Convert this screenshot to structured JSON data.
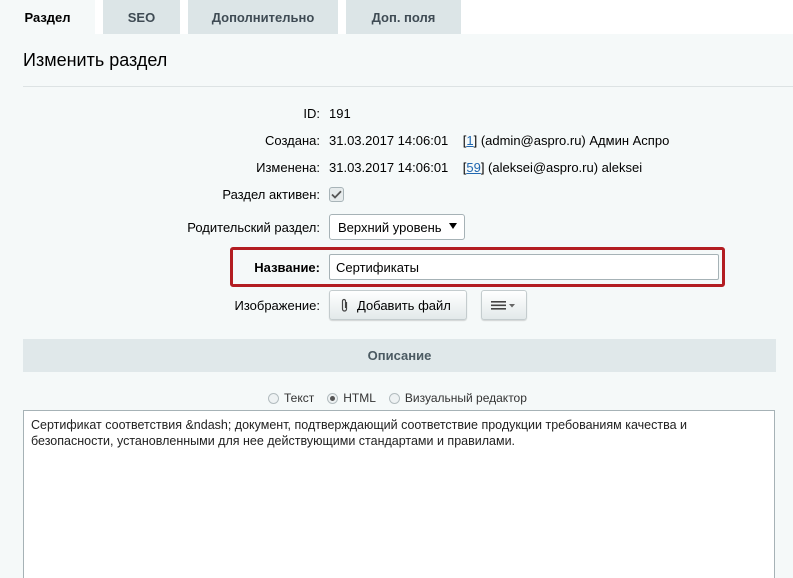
{
  "tabs": [
    {
      "label": "Раздел",
      "active": true
    },
    {
      "label": "SEO",
      "active": false
    },
    {
      "label": "Дополнительно",
      "active": false
    },
    {
      "label": "Доп. поля",
      "active": false
    }
  ],
  "page": {
    "title": "Изменить раздел"
  },
  "fields": {
    "id": {
      "label": "ID:",
      "value": "191"
    },
    "created": {
      "label": "Создана:",
      "date": "31.03.2017 14:06:01",
      "user_link": "1",
      "user_text": "(admin@aspro.ru) Админ Аспро"
    },
    "modified": {
      "label": "Изменена:",
      "date": "31.03.2017 14:06:01",
      "user_link": "59",
      "user_text": "(aleksei@aspro.ru) aleksei"
    },
    "active": {
      "label": "Раздел активен:",
      "checked": true
    },
    "parent": {
      "label": "Родительский раздел:",
      "value": "Верхний уровень"
    },
    "name": {
      "label": "Название:",
      "value": "Сертификаты"
    },
    "image": {
      "label": "Изображение:",
      "button": "Добавить файл"
    }
  },
  "description": {
    "section_title": "Описание",
    "modes": [
      {
        "label": "Текст",
        "selected": false
      },
      {
        "label": "HTML",
        "selected": true
      },
      {
        "label": "Визуальный редактор",
        "selected": false
      }
    ],
    "text": "Сертификат соответствия &ndash; документ, подтверждающий соответствие продукции требованиям качества и безопасности, установленными для нее действующими стандартами и правилами."
  },
  "colors": {
    "highlight": "#b31d22",
    "tab_bg": "#dce5e7",
    "panel_bg": "#f5f9f9",
    "link": "#2067b0"
  },
  "icons": {
    "checkbox": "checkmark-icon",
    "select": "caret-down-icon",
    "attach": "paperclip-icon",
    "menu": "hamburger-menu-icon"
  }
}
